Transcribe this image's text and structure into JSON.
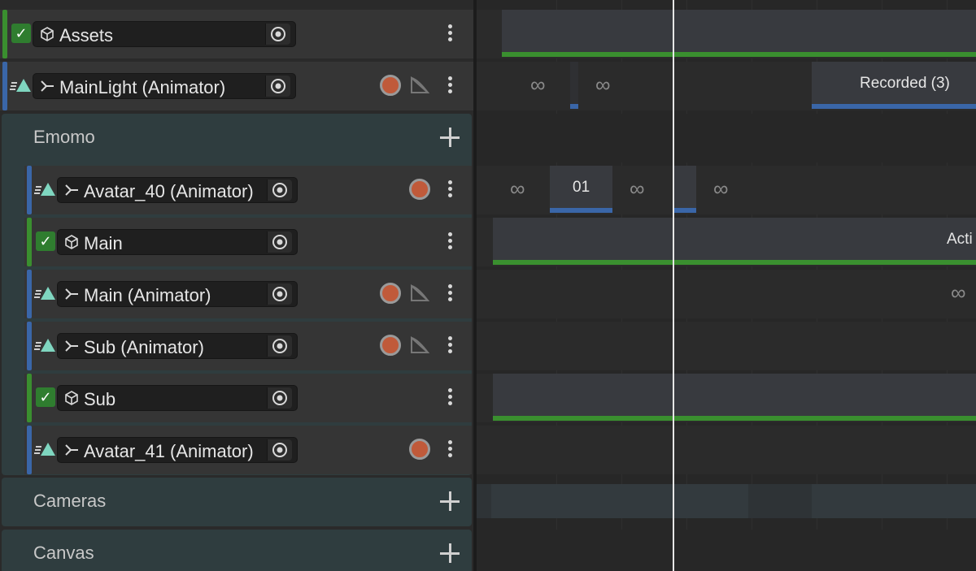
{
  "tracks": {
    "assets": {
      "label": "Assets"
    },
    "mainlight": {
      "label": "MainLight (Animator)"
    },
    "avatar40": {
      "label": "Avatar_40 (Animator)"
    },
    "main": {
      "label": "Main"
    },
    "main_anim": {
      "label": "Main (Animator)"
    },
    "sub_anim": {
      "label": "Sub (Animator)"
    },
    "sub": {
      "label": "Sub"
    },
    "avatar41": {
      "label": "Avatar_41 (Animator)"
    }
  },
  "groups": {
    "emomo": {
      "label": "Emomo"
    },
    "cameras": {
      "label": "Cameras"
    },
    "canvas": {
      "label": "Canvas"
    }
  },
  "clips": {
    "recorded": {
      "label": "Recorded (3)"
    },
    "avatar40_clip": {
      "label": "01"
    },
    "main_active": {
      "label": "Acti"
    }
  },
  "loop_glyph": "∞",
  "colors": {
    "activation_green": "#3a8f2f",
    "animation_blue": "#3a66a8",
    "record_red": "#c05a3a",
    "group_teal": "#2f3d3f"
  },
  "icons": [
    "check-icon",
    "cube-icon",
    "animator-icon",
    "target-icon",
    "record-icon",
    "curve-icon",
    "kebab-icon",
    "plus-icon",
    "loop-icon"
  ]
}
